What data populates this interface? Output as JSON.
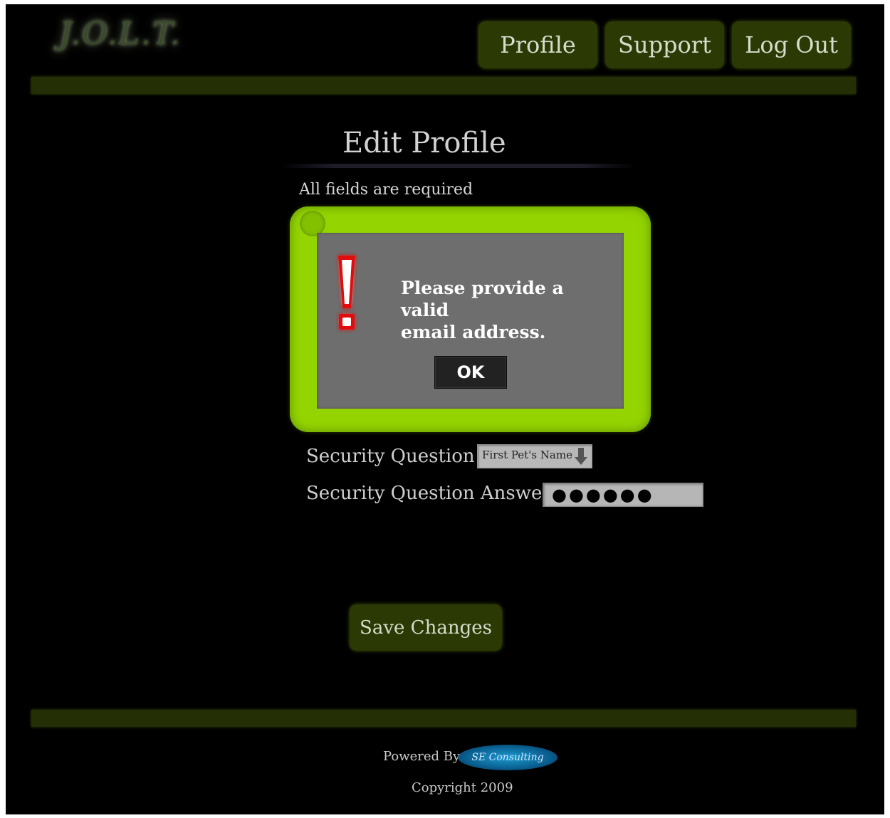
{
  "header": {
    "logo_text": "J.O.L.T.",
    "nav": {
      "profile_label": "Profile",
      "support_label": "Support",
      "logout_label": "Log Out"
    }
  },
  "page": {
    "title": "Edit Profile",
    "required_note": "All fields are required"
  },
  "dialog": {
    "icon": "exclamation-icon",
    "message_line1": "Please provide a valid",
    "message_line2": "email address.",
    "ok_label": "OK"
  },
  "form": {
    "security_question_label": "Security Question",
    "security_question_value": "First Pet's Name",
    "security_answer_label": "Security Question Answer",
    "security_answer_value": "●●●●●●"
  },
  "actions": {
    "save_label": "Save Changes"
  },
  "footer": {
    "powered_by_label": "Powered By",
    "partner_logo_text": "SE Consulting",
    "copyright": "Copyright 2009"
  },
  "colors": {
    "background": "#000000",
    "accent_green": "#94d400",
    "button_dark_green": "#2b3a04",
    "dialog_gray": "#6e6e6e",
    "alert_red": "#e11010"
  }
}
